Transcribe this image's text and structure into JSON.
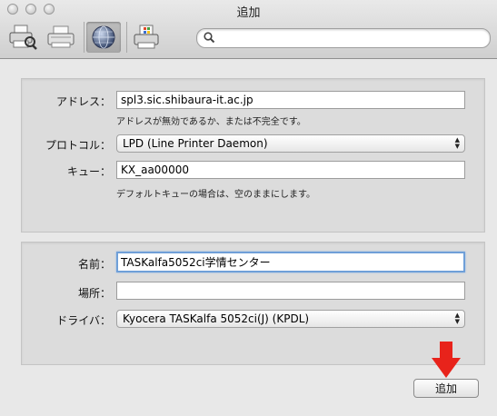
{
  "window": {
    "title": "追加"
  },
  "toolbar": {
    "buttons": [
      {
        "icon": "default-printer-icon"
      },
      {
        "icon": "fax-icon"
      },
      {
        "icon": "ip-globe-icon",
        "selected": true
      },
      {
        "icon": "windows-printer-icon"
      }
    ],
    "search": {
      "value": "",
      "placeholder": ""
    }
  },
  "address": {
    "label": "アドレス：",
    "value": "spl3.sic.shibaura-it.ac.jp",
    "status": "アドレスが無効であるか、または不完全です。"
  },
  "protocol": {
    "label": "プロトコル：",
    "value": "LPD (Line Printer Daemon)"
  },
  "queue": {
    "label": "キュー：",
    "value": "KX_aa00000",
    "hint": "デフォルトキューの場合は、空のままにします。"
  },
  "name": {
    "label": "名前：",
    "value": "TASKalfa5052ci学情センター"
  },
  "location": {
    "label": "場所：",
    "value": ""
  },
  "driver": {
    "label": "ドライバ：",
    "value": "Kyocera TASKalfa 5052ci(J) (KPDL)"
  },
  "footer": {
    "add_button": "追加"
  },
  "colors": {
    "focus": "#6f9fd8",
    "arrow": "#e8231b"
  }
}
